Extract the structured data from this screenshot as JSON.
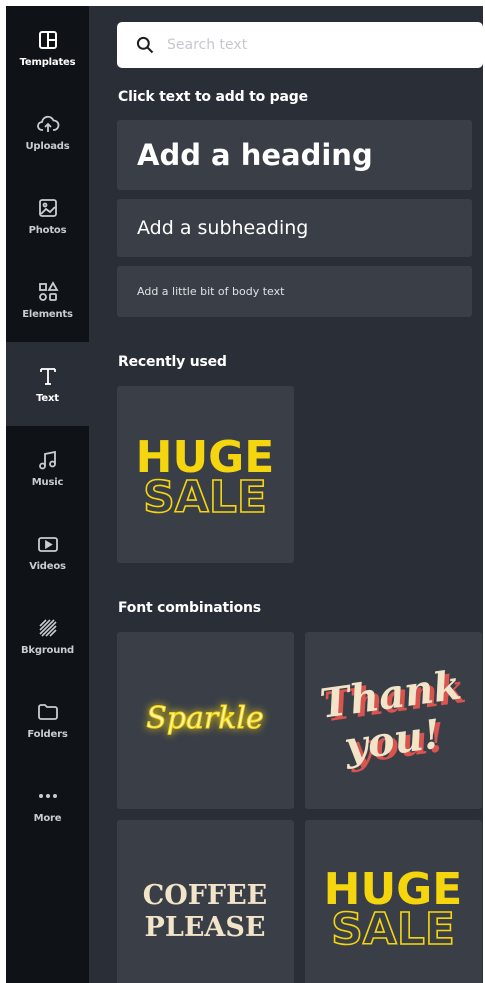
{
  "sidebar": {
    "items": [
      {
        "label": "Templates",
        "icon": "templates-icon"
      },
      {
        "label": "Uploads",
        "icon": "cloud-upload-icon"
      },
      {
        "label": "Photos",
        "icon": "photo-icon"
      },
      {
        "label": "Elements",
        "icon": "shapes-icon"
      },
      {
        "label": "Text",
        "icon": "text-icon",
        "active": true
      },
      {
        "label": "Music",
        "icon": "music-note-icon"
      },
      {
        "label": "Videos",
        "icon": "video-play-icon"
      },
      {
        "label": "Bkground",
        "icon": "pattern-icon"
      },
      {
        "label": "Folders",
        "icon": "folder-icon"
      },
      {
        "label": "More",
        "icon": "more-dots-icon"
      }
    ]
  },
  "search": {
    "placeholder": "Search text"
  },
  "add_text": {
    "title": "Click text to add to page",
    "heading": "Add a heading",
    "subheading": "Add a subheading",
    "body": "Add a little bit of body text"
  },
  "recently_used": {
    "title": "Recently used",
    "items": [
      {
        "line1": "HUGE",
        "line2": "SALE"
      }
    ]
  },
  "font_combinations": {
    "title": "Font combinations",
    "items": [
      {
        "text": "Sparkle"
      },
      {
        "line1": "Thank",
        "line2": "you!"
      },
      {
        "line1": "COFFEE",
        "line2": "PLEASE"
      },
      {
        "line1": "HUGE",
        "line2": "SALE"
      }
    ]
  },
  "colors": {
    "sidebar_bg": "#0f1216",
    "panel_bg": "#2a2f37",
    "card_bg": "#3a3f47",
    "accent_yellow": "#f5d60e",
    "cream": "#f1e4c9",
    "coral_shadow": "#d9534f"
  }
}
